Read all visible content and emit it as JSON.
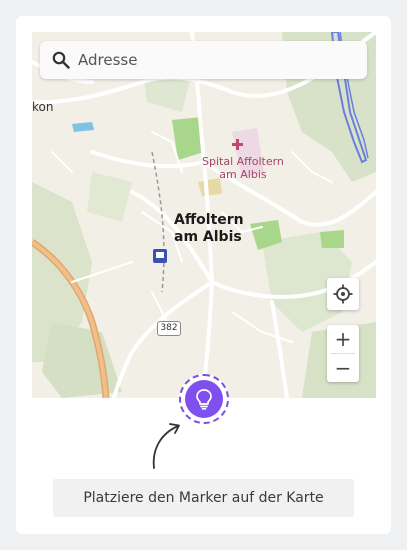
{
  "search": {
    "placeholder": "Adresse",
    "icon": "search-icon"
  },
  "map": {
    "labels": {
      "town": [
        "Affoltern",
        "am Albis"
      ],
      "hospital": [
        "Spital Affoltern",
        "am Albis"
      ],
      "place_partial": "kon",
      "road_number": "382"
    },
    "controls": {
      "locate_icon": "crosshair-icon",
      "zoom_in": "+",
      "zoom_out": "−"
    }
  },
  "marker_button": {
    "icon": "lightbulb-icon",
    "color": "#7f4ff0"
  },
  "hint": {
    "text": "Platziere den Marker auf der Karte"
  }
}
